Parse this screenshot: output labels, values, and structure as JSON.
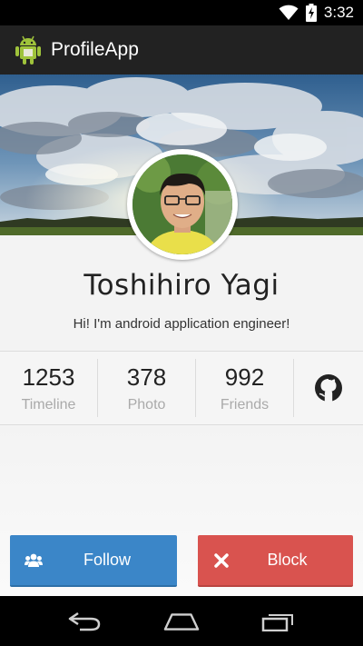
{
  "status_bar": {
    "time": "3:32",
    "icons": [
      "wifi-icon",
      "battery-charging-icon"
    ]
  },
  "action_bar": {
    "app_icon": "android-icon",
    "title": "ProfileApp"
  },
  "profile": {
    "cover_image": "cloudy-sky-landscape",
    "avatar": "user-photo",
    "name": "Toshihiro Yagi",
    "bio": "Hi! I'm android application engineer!"
  },
  "stats": [
    {
      "value": "1253",
      "label": "Timeline"
    },
    {
      "value": "378",
      "label": "Photo"
    },
    {
      "value": "992",
      "label": "Friends"
    }
  ],
  "github_icon": "github-icon",
  "actions": {
    "follow": {
      "label": "Follow",
      "icon": "users-icon",
      "color": "#3b86c8"
    },
    "block": {
      "label": "Block",
      "icon": "close-icon",
      "color": "#d9534f"
    }
  },
  "nav_bar": {
    "buttons": [
      "back-icon",
      "home-icon",
      "recent-apps-icon"
    ]
  }
}
